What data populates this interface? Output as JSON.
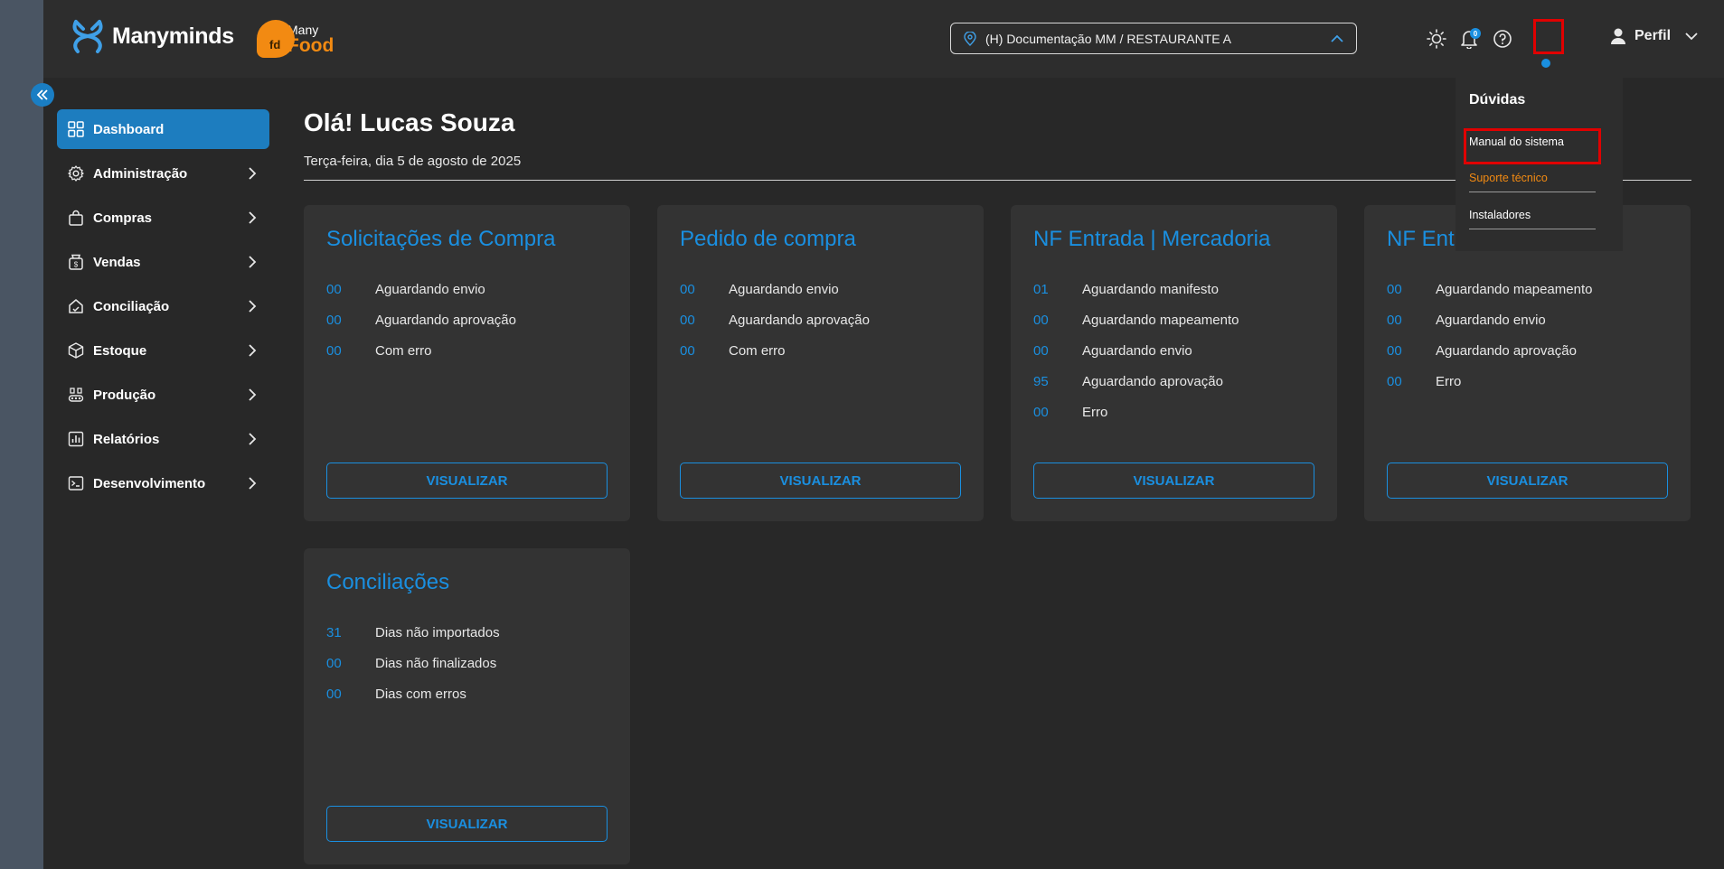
{
  "header": {
    "brand": "Manyminds",
    "food_logo": {
      "badge": "fd",
      "top": "Many",
      "bottom": "Food"
    },
    "location": "(H) Documentação MM / RESTAURANTE A",
    "notification_count": "0",
    "profile_label": "Perfil"
  },
  "sidebar": {
    "items": [
      {
        "label": "Dashboard",
        "icon": "dashboard-grid-icon",
        "active": true
      },
      {
        "label": "Administração",
        "icon": "gear-icon"
      },
      {
        "label": "Compras",
        "icon": "shopping-bag-icon"
      },
      {
        "label": "Vendas",
        "icon": "money-bag-icon"
      },
      {
        "label": "Conciliação",
        "icon": "reconciliation-icon"
      },
      {
        "label": "Estoque",
        "icon": "box-icon"
      },
      {
        "label": "Produção",
        "icon": "production-icon"
      },
      {
        "label": "Relatórios",
        "icon": "chart-icon"
      },
      {
        "label": "Desenvolvimento",
        "icon": "terminal-icon"
      }
    ]
  },
  "main": {
    "greeting": "Olá! Lucas Souza",
    "date": "Terça-feira, dia 5 de agosto de 2025",
    "cards": [
      {
        "title": "Solicitações de Compra",
        "rows": [
          {
            "num": "00",
            "label": "Aguardando envio"
          },
          {
            "num": "00",
            "label": "Aguardando aprovação"
          },
          {
            "num": "00",
            "label": "Com erro"
          }
        ],
        "button": "VISUALIZAR"
      },
      {
        "title": "Pedido de compra",
        "rows": [
          {
            "num": "00",
            "label": "Aguardando envio"
          },
          {
            "num": "00",
            "label": "Aguardando aprovação"
          },
          {
            "num": "00",
            "label": "Com erro"
          }
        ],
        "button": "VISUALIZAR"
      },
      {
        "title": "NF Entrada | Mercadoria",
        "rows": [
          {
            "num": "01",
            "label": "Aguardando manifesto"
          },
          {
            "num": "00",
            "label": "Aguardando mapeamento"
          },
          {
            "num": "00",
            "label": "Aguardando envio"
          },
          {
            "num": "95",
            "label": "Aguardando aprovação"
          },
          {
            "num": "00",
            "label": "Erro"
          }
        ],
        "button": "VISUALIZAR"
      },
      {
        "title": "NF Ent",
        "rows": [
          {
            "num": "00",
            "label": "Aguardando mapeamento"
          },
          {
            "num": "00",
            "label": "Aguardando envio"
          },
          {
            "num": "00",
            "label": "Aguardando aprovação"
          },
          {
            "num": "00",
            "label": "Erro"
          }
        ],
        "button": "VISUALIZAR"
      },
      {
        "title": "Conciliações",
        "rows": [
          {
            "num": "31",
            "label": "Dias não importados"
          },
          {
            "num": "00",
            "label": "Dias não finalizados"
          },
          {
            "num": "00",
            "label": "Dias com erros"
          }
        ],
        "button": "VISUALIZAR"
      }
    ]
  },
  "help_menu": {
    "title": "Dúvidas",
    "items": [
      "Manual do sistema",
      "Suporte técnico",
      "Instaladores"
    ]
  },
  "colors": {
    "accent": "#1a8fe0",
    "active_nav": "#1d7dbf",
    "orange": "#f28a12",
    "highlight": "#e00000",
    "background": "#282828",
    "card": "#333333"
  }
}
